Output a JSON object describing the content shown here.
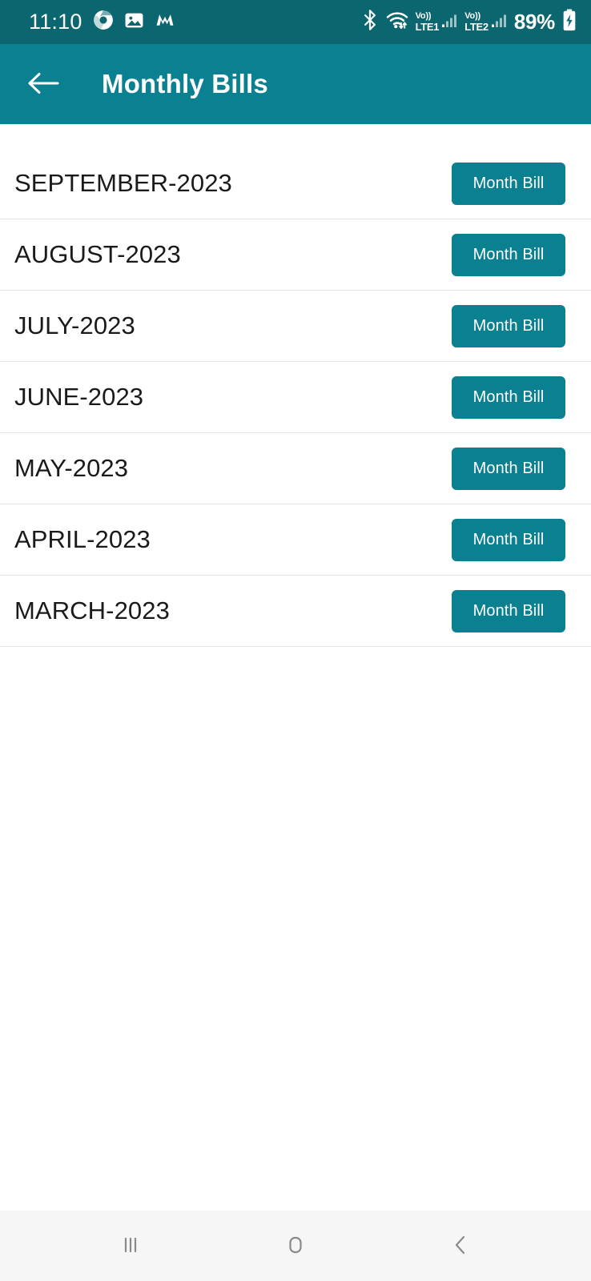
{
  "status_bar": {
    "clock": "11:10",
    "battery_percent": "89%",
    "background_color": "#0c6670",
    "left_icons": [
      {
        "name": "chrome-icon"
      },
      {
        "name": "gallery-image-icon"
      },
      {
        "name": "m-app-icon"
      }
    ],
    "right_icons": [
      {
        "name": "bluetooth-icon"
      },
      {
        "name": "wifi-icon"
      }
    ],
    "sim1": {
      "volte": "Vo))",
      "network": "LTE1"
    },
    "sim2": {
      "volte": "Vo))",
      "network": "LTE2"
    }
  },
  "app_bar": {
    "title": "Monthly Bills",
    "back_icon": "arrow-left-icon",
    "background_color": "#0a8090",
    "text_color": "#ffffff"
  },
  "theme": {
    "primary": "#0a8090",
    "primary_dark": "#0c6670",
    "divider": "#e4e4e4",
    "page_background": "#ffffff",
    "nav_background": "#f6f6f6",
    "nav_icon_color": "#8a8a8a"
  },
  "bills": [
    {
      "month": "SEPTEMBER-2023",
      "button_label": "Month Bill"
    },
    {
      "month": "AUGUST-2023",
      "button_label": "Month Bill"
    },
    {
      "month": "JULY-2023",
      "button_label": "Month Bill"
    },
    {
      "month": "JUNE-2023",
      "button_label": "Month Bill"
    },
    {
      "month": "MAY-2023",
      "button_label": "Month Bill"
    },
    {
      "month": "APRIL-2023",
      "button_label": "Month Bill"
    },
    {
      "month": "MARCH-2023",
      "button_label": "Month Bill"
    }
  ],
  "nav_bar": {
    "items": [
      {
        "name": "recents-button",
        "icon": "recents-icon"
      },
      {
        "name": "home-button",
        "icon": "home-icon"
      },
      {
        "name": "back-button",
        "icon": "chevron-left-icon"
      }
    ]
  }
}
